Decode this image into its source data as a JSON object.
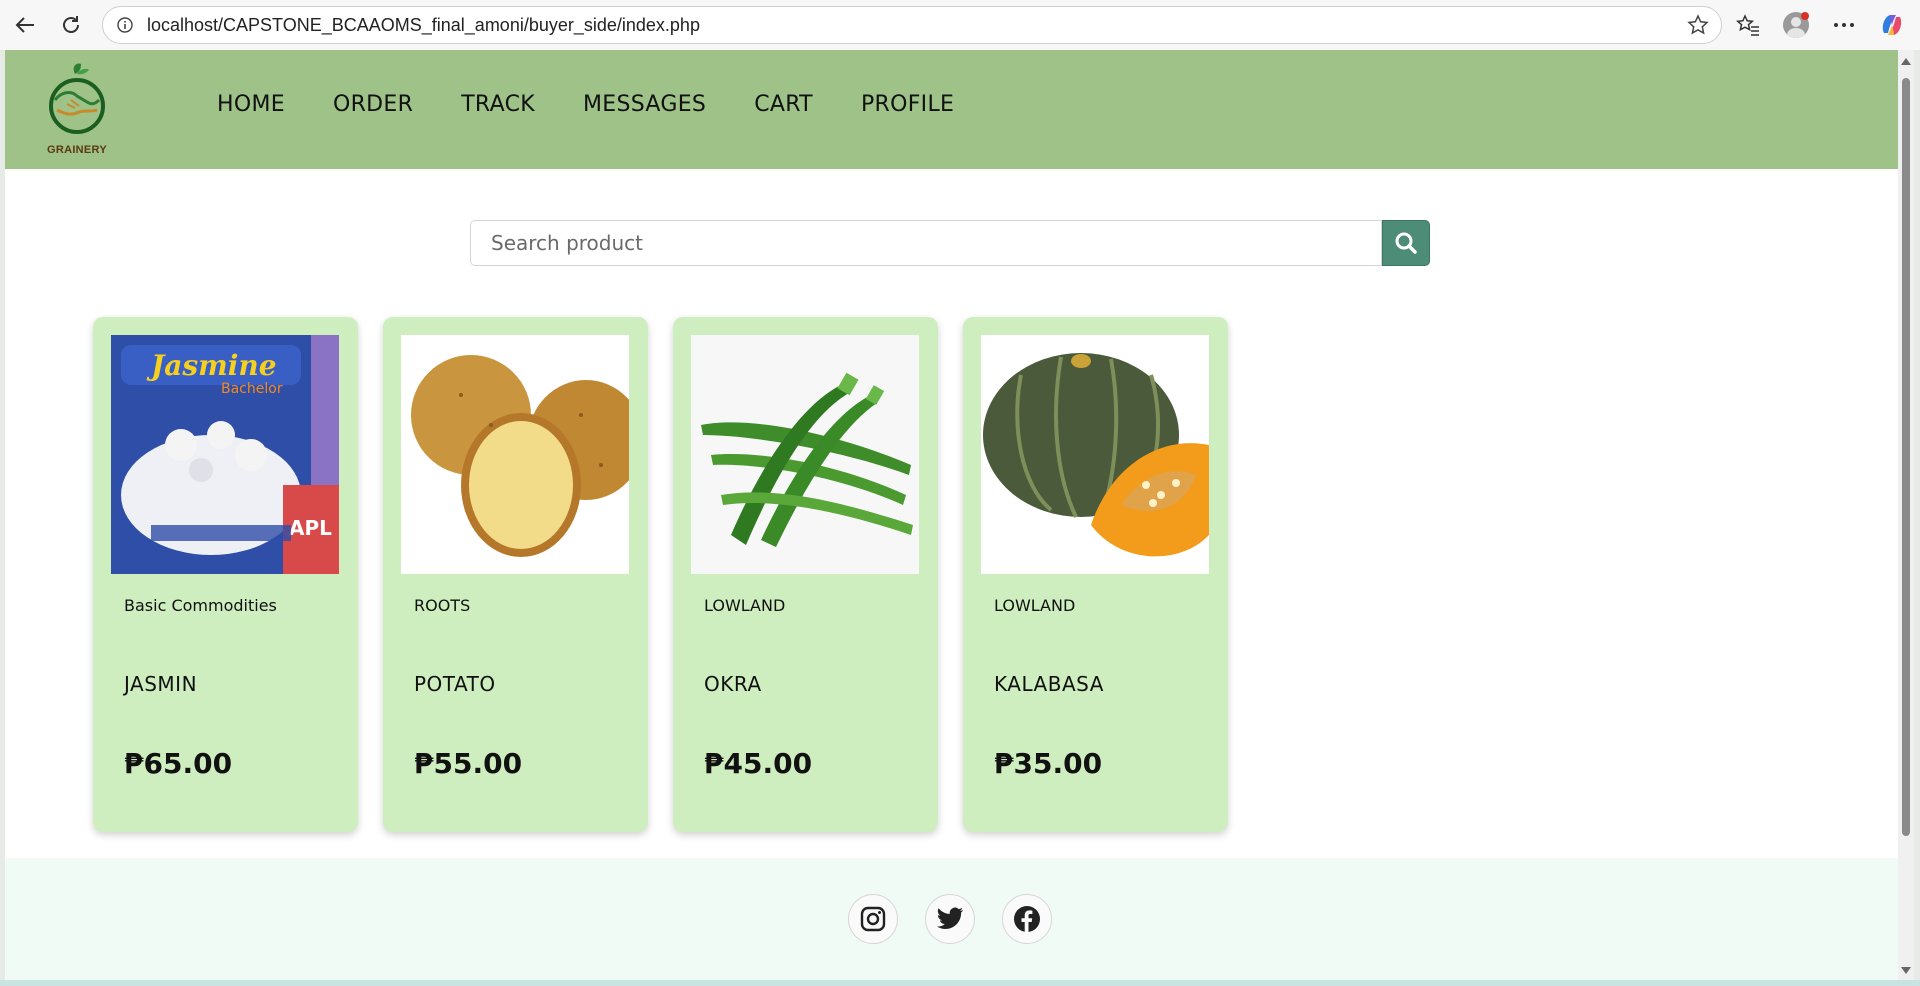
{
  "browser": {
    "url": "localhost/CAPSTONE_BCAAOMS_final_amoni/buyer_side/index.php"
  },
  "header": {
    "logo_text": "GRAINERY",
    "nav": [
      "HOME",
      "ORDER",
      "TRACK",
      "MESSAGES",
      "CART",
      "PROFILE"
    ]
  },
  "search": {
    "placeholder": "Search product"
  },
  "products": [
    {
      "category": "Basic Commodities",
      "name": "JASMIN",
      "price": "₱65.00",
      "image": "jasmine-rice-bag"
    },
    {
      "category": "ROOTS",
      "name": "POTATO",
      "price": "₱55.00",
      "image": "potatoes"
    },
    {
      "category": "LOWLAND",
      "name": "OKRA",
      "price": "₱45.00",
      "image": "okra"
    },
    {
      "category": "LOWLAND",
      "name": "KALABASA",
      "price": "₱35.00",
      "image": "squash"
    }
  ],
  "footer": {
    "social": [
      "instagram-icon",
      "twitter-icon",
      "facebook-icon"
    ]
  },
  "colors": {
    "header_bg": "#9ec287",
    "card_bg": "#cfeebf",
    "search_button": "#4d8c77",
    "footer_bg": "#f1fbf6"
  }
}
